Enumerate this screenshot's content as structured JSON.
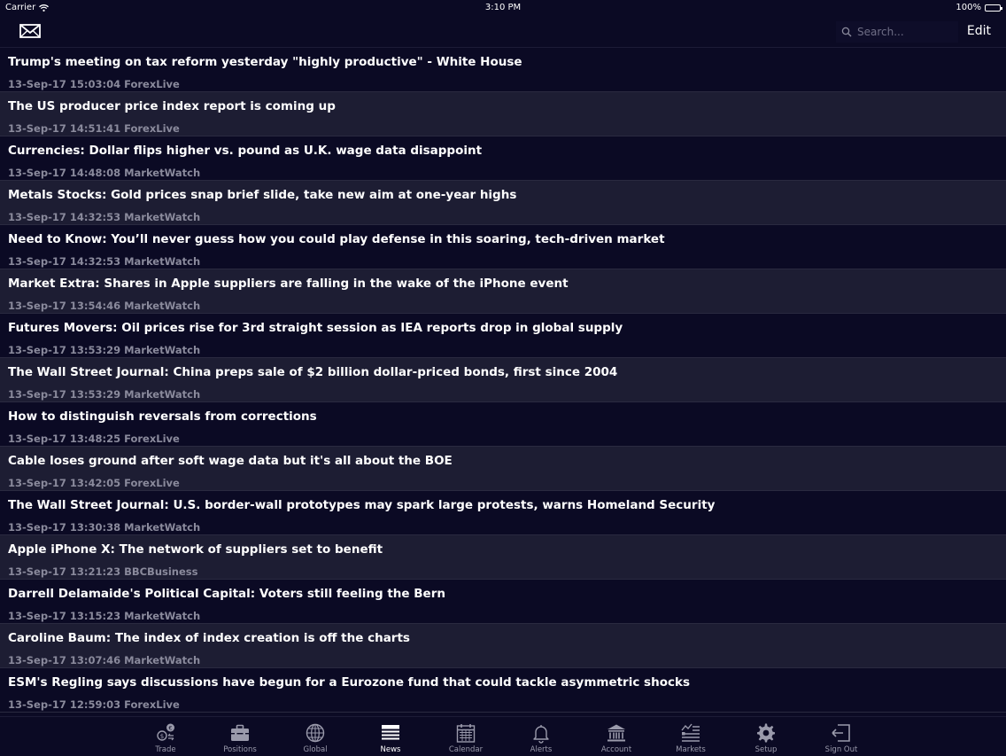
{
  "status_bar": {
    "carrier": "Carrier",
    "time": "3:10 PM",
    "battery": "100%"
  },
  "nav": {
    "search_placeholder": "Search...",
    "edit_label": "Edit"
  },
  "news": [
    {
      "headline": "Trump's meeting on tax reform yesterday \"highly productive\" - White House",
      "meta": "13-Sep-17 15:03:04 ForexLive"
    },
    {
      "headline": "The US producer price index report is coming up",
      "meta": "13-Sep-17 14:51:41 ForexLive"
    },
    {
      "headline": "Currencies: Dollar flips higher vs. pound as U.K. wage data disappoint",
      "meta": "13-Sep-17 14:48:08 MarketWatch"
    },
    {
      "headline": "Metals Stocks: Gold prices snap brief slide, take new aim at one-year highs",
      "meta": "13-Sep-17 14:32:53 MarketWatch"
    },
    {
      "headline": "Need to Know: You’ll never guess how you could play defense in this soaring, tech-driven market",
      "meta": "13-Sep-17 14:32:53 MarketWatch"
    },
    {
      "headline": "Market Extra: Shares in Apple suppliers are falling in the wake of the iPhone event",
      "meta": "13-Sep-17 13:54:46 MarketWatch"
    },
    {
      "headline": "Futures Movers: Oil prices rise for 3rd straight session as IEA reports drop in global supply",
      "meta": "13-Sep-17 13:53:29 MarketWatch"
    },
    {
      "headline": "The Wall Street Journal: China preps sale of $2 billion dollar-priced bonds, first since 2004",
      "meta": "13-Sep-17 13:53:29 MarketWatch"
    },
    {
      "headline": "How to distinguish reversals from corrections",
      "meta": "13-Sep-17 13:48:25 ForexLive"
    },
    {
      "headline": "Cable loses ground after soft wage data but it's all about the BOE",
      "meta": "13-Sep-17 13:42:05 ForexLive"
    },
    {
      "headline": "The Wall Street Journal: U.S. border-wall prototypes may spark large protests, warns Homeland Security",
      "meta": "13-Sep-17 13:30:38 MarketWatch"
    },
    {
      "headline": "Apple iPhone X: The network of suppliers set to benefit",
      "meta": "13-Sep-17 13:21:23 BBCBusiness"
    },
    {
      "headline": "Darrell Delamaide's Political Capital: Voters still feeling the Bern",
      "meta": "13-Sep-17 13:15:23 MarketWatch"
    },
    {
      "headline": "Caroline Baum: The index of index creation is off the charts",
      "meta": "13-Sep-17 13:07:46 MarketWatch"
    },
    {
      "headline": "ESM's Regling says discussions have begun for a Eurozone fund that could tackle asymmetric shocks",
      "meta": "13-Sep-17 12:59:03 ForexLive"
    }
  ],
  "tabs": [
    {
      "label": "Trade",
      "icon": "trade-icon",
      "active": false
    },
    {
      "label": "Positions",
      "icon": "briefcase-icon",
      "active": false
    },
    {
      "label": "Global",
      "icon": "globe-icon",
      "active": false
    },
    {
      "label": "News",
      "icon": "news-icon",
      "active": true
    },
    {
      "label": "Calendar",
      "icon": "calendar-icon",
      "active": false
    },
    {
      "label": "Alerts",
      "icon": "bell-icon",
      "active": false
    },
    {
      "label": "Account",
      "icon": "bank-icon",
      "active": false
    },
    {
      "label": "Markets",
      "icon": "markets-list-icon",
      "active": false
    },
    {
      "label": "Setup",
      "icon": "gear-icon",
      "active": false
    },
    {
      "label": "Sign Out",
      "icon": "sign-out-icon",
      "active": false
    }
  ],
  "colors": {
    "background": "#0b0a24",
    "row_alt": "#1d1d33",
    "meta_text": "#8a8a9c"
  }
}
